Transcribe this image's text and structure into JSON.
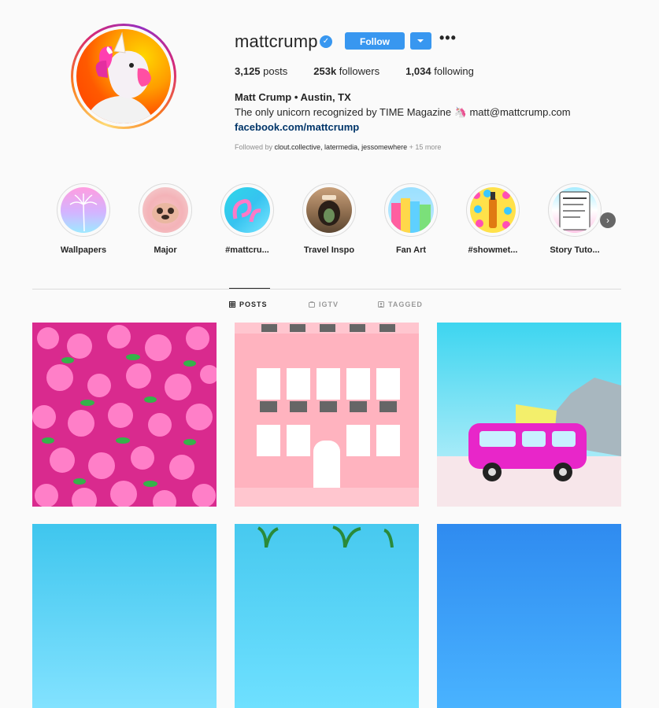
{
  "profile": {
    "username": "mattcrump",
    "verified_icon": "verified-badge-icon",
    "follow_label": "Follow",
    "more_label": "•••",
    "stats": {
      "posts_count": "3,125",
      "posts_label": "posts",
      "followers_count": "253k",
      "followers_label": "followers",
      "following_count": "1,034",
      "following_label": "following"
    },
    "bio_name": "Matt Crump • Austin, TX",
    "bio_text": "The only unicorn recognized by TIME Magazine 🦄 matt@mattcrump.com",
    "bio_link": "facebook.com/mattcrump",
    "followed_by_prefix": "Followed by ",
    "followed_by_names": "clout.collective, latermedia, jessomewhere",
    "followed_by_more": " + 15 more"
  },
  "highlights": [
    {
      "label": "Wallpapers"
    },
    {
      "label": "Major"
    },
    {
      "label": "#mattcru..."
    },
    {
      "label": "Travel Inspo"
    },
    {
      "label": "Fan Art"
    },
    {
      "label": "#showmet..."
    },
    {
      "label": "Story Tuto..."
    }
  ],
  "highlights_next_icon": "chevron-right-icon",
  "tabs": [
    {
      "label": "POSTS",
      "icon": "grid-icon",
      "active": true
    },
    {
      "label": "IGTV",
      "icon": "igtv-icon",
      "active": false
    },
    {
      "label": "TAGGED",
      "icon": "tagged-icon",
      "active": false
    }
  ],
  "colors": {
    "accent": "#3897f0",
    "link": "#003569",
    "muted": "#8e8e8e",
    "background": "#fafafa"
  }
}
